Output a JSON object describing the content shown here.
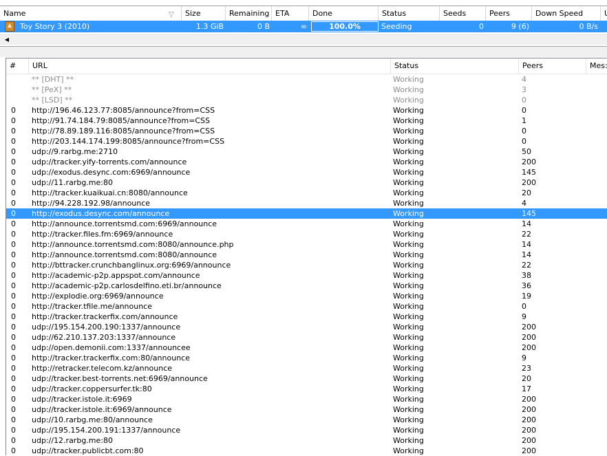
{
  "torrents": {
    "columns": [
      "Name",
      "Size",
      "Remaining",
      "ETA",
      "Done",
      "Status",
      "Seeds",
      "Peers",
      "Down Speed",
      "U"
    ],
    "rows": [
      {
        "name": "Toy Story 3 (2010)",
        "size": "1.3 GiB",
        "remaining": "0 B",
        "eta": "∞",
        "done": "100.0%",
        "done_fraction": 1.0,
        "status": "Seeding",
        "seeds": "0",
        "peers": "9 (6)",
        "down_speed": "0 B/s"
      }
    ]
  },
  "trackers": {
    "columns": [
      "#",
      "URL",
      "Status",
      "Peers",
      "Mes:"
    ],
    "rows": [
      {
        "num": "",
        "url": "** [DHT] **",
        "status": "Working",
        "peers": "4",
        "dim": true
      },
      {
        "num": "",
        "url": "** [PeX] **",
        "status": "Working",
        "peers": "3",
        "dim": true
      },
      {
        "num": "",
        "url": "** [LSD] **",
        "status": "Working",
        "peers": "0",
        "dim": true
      },
      {
        "num": "0",
        "url": "http://196.46.123.77:8085/announce?from=CSS",
        "status": "Working",
        "peers": "0"
      },
      {
        "num": "0",
        "url": "http://91.74.184.79:8085/announce?from=CSS",
        "status": "Working",
        "peers": "1"
      },
      {
        "num": "0",
        "url": "http://78.89.189.116:8085/announce?from=CSS",
        "status": "Working",
        "peers": "0"
      },
      {
        "num": "0",
        "url": "http://203.144.174.199:8085/announce?from=CSS",
        "status": "Working",
        "peers": "0"
      },
      {
        "num": "0",
        "url": "udp://9.rarbg.me:2710",
        "status": "Working",
        "peers": "50"
      },
      {
        "num": "0",
        "url": "udp://tracker.yify-torrents.com/announce",
        "status": "Working",
        "peers": "200"
      },
      {
        "num": "0",
        "url": "udp://exodus.desync.com:6969/announce",
        "status": "Working",
        "peers": "145"
      },
      {
        "num": "0",
        "url": "udp://11.rarbg.me:80",
        "status": "Working",
        "peers": "200"
      },
      {
        "num": "0",
        "url": "http://tracker.kuaikuai.cn:8080/announce",
        "status": "Working",
        "peers": "20"
      },
      {
        "num": "0",
        "url": "http://94.228.192.98/announce",
        "status": "Working",
        "peers": "4"
      },
      {
        "num": "0",
        "url": "http://exodus.desync.com/announce",
        "status": "Working",
        "peers": "145",
        "selected": true
      },
      {
        "num": "0",
        "url": "http://announce.torrentsmd.com:6969/announce",
        "status": "Working",
        "peers": "14"
      },
      {
        "num": "0",
        "url": "http://tracker.files.fm:6969/announce",
        "status": "Working",
        "peers": "22"
      },
      {
        "num": "0",
        "url": "http://announce.torrentsmd.com:8080/announce.php",
        "status": "Working",
        "peers": "14"
      },
      {
        "num": "0",
        "url": "http://announce.torrentsmd.com:8080/announce",
        "status": "Working",
        "peers": "14"
      },
      {
        "num": "0",
        "url": "http://bttracker.crunchbanglinux.org:6969/announce",
        "status": "Working",
        "peers": "22"
      },
      {
        "num": "0",
        "url": "http://academic-p2p.appspot.com/announce",
        "status": "Working",
        "peers": "38"
      },
      {
        "num": "0",
        "url": "http://academic-p2p.carlosdelfino.eti.br/announce",
        "status": "Working",
        "peers": "36"
      },
      {
        "num": "0",
        "url": "http://explodie.org:6969/announce",
        "status": "Working",
        "peers": "19"
      },
      {
        "num": "0",
        "url": "http://tracker.tfile.me/announce",
        "status": "Working",
        "peers": "0"
      },
      {
        "num": "0",
        "url": "http://tracker.trackerfix.com/announce",
        "status": "Working",
        "peers": "9"
      },
      {
        "num": "0",
        "url": "udp://195.154.200.190:1337/announce",
        "status": "Working",
        "peers": "200"
      },
      {
        "num": "0",
        "url": "udp://62.210.137.203:1337/announce",
        "status": "Working",
        "peers": "200"
      },
      {
        "num": "0",
        "url": "udp://open.demonii.com:1337/announcee",
        "status": "Working",
        "peers": "200"
      },
      {
        "num": "0",
        "url": "http://tracker.trackerfix.com:80/announce",
        "status": "Working",
        "peers": "9"
      },
      {
        "num": "0",
        "url": "http://retracker.telecom.kz/announce",
        "status": "Working",
        "peers": "23"
      },
      {
        "num": "0",
        "url": "udp://tracker.best-torrents.net:6969/announce",
        "status": "Working",
        "peers": "20"
      },
      {
        "num": "0",
        "url": "udp://tracker.coppersurfer.tk:80",
        "status": "Working",
        "peers": "17"
      },
      {
        "num": "0",
        "url": "udp://tracker.istole.it:6969",
        "status": "Working",
        "peers": "200"
      },
      {
        "num": "0",
        "url": "udp://tracker.istole.it:6969/announce",
        "status": "Working",
        "peers": "200"
      },
      {
        "num": "0",
        "url": "udp://10.rarbg.me:80/announce",
        "status": "Working",
        "peers": "200"
      },
      {
        "num": "0",
        "url": "udp://195.154.200.191:1337/announce",
        "status": "Working",
        "peers": "200"
      },
      {
        "num": "0",
        "url": "udp://12.rarbg.me:80",
        "status": "Working",
        "peers": "200"
      },
      {
        "num": "0",
        "url": "udp://tracker.publicbt.com:80",
        "status": "Working",
        "peers": "200"
      }
    ]
  },
  "colors": {
    "selection": "#3399ff",
    "dim_text": "#8c8c8c",
    "seed_icon": "#d08a30"
  },
  "icons": {
    "sort": "sort-descending-icon",
    "torrent_status": "seeding-icon",
    "scroll_left": "scroll-left-arrow-icon"
  }
}
